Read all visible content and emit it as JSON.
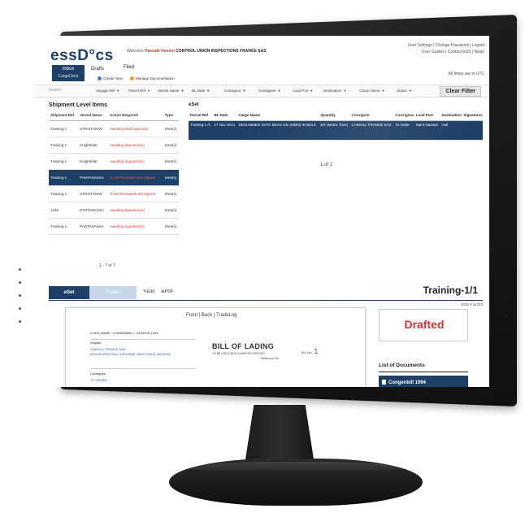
{
  "header": {
    "logo": "essD°cs",
    "welcome_prefix": "Welcome",
    "user_name": "Pascale Hossin",
    "company": "CONTROL UNION INSPECTIONS FRANCE SAS",
    "links_line1": "User Settings | Change Password | Logout",
    "links_line2": "User Guides | Contact ESS | News",
    "times_note": "All times are in UTC"
  },
  "tabs": {
    "inbox": "Inbox",
    "inbox_sub": "CargoDocs",
    "drafts": "Drafts",
    "filed": "Filed",
    "create_new": "Create New",
    "manage_docs": "Manage Documentation"
  },
  "filters": {
    "search_placeholder": "Search",
    "items": [
      "Voyage Ref",
      "Parcel Ref",
      "Vessel Name",
      "BL Date",
      "Consignor",
      "Consignee",
      "Load Port",
      "Destination",
      "Cargo Name",
      "Status"
    ],
    "clear_label": "Clear Filter"
  },
  "shipments": {
    "title": "Shipment Level Items",
    "columns": [
      "Shipment Ref",
      "Vessel Name",
      "Action Required",
      "Type"
    ],
    "rows": [
      {
        "ref": "Training-1",
        "vessel": "STRAITVIEW",
        "action": "Awaiting Draft Approval",
        "type": "eSet(s)",
        "selected": false
      },
      {
        "ref": "Training-1",
        "vessel": "Knightrider",
        "action": "Awaiting Signature(s)",
        "type": "eSet(s)",
        "selected": false
      },
      {
        "ref": "Training-1",
        "vessel": "Knightrider",
        "action": "Awaiting Signature(s)",
        "type": "eSet(s)",
        "selected": false
      },
      {
        "ref": "Training-1",
        "vessel": "PANTANASSA",
        "action": "To be Reviewed and Signed",
        "type": "eSet(s)",
        "selected": true
      },
      {
        "ref": "Training-1",
        "vessel": "STRAITVIEW",
        "action": "To be Reviewed and Signed",
        "type": "eSet(s)",
        "selected": false
      },
      {
        "ref": "1240",
        "vessel": "PANTANASSA",
        "action": "Awaiting Signature(s)",
        "type": "eSet(s)",
        "selected": false
      },
      {
        "ref": "Training-1",
        "vessel": "PANTANASSA",
        "action": "Awaiting Signature(s)",
        "type": "eSet(s)",
        "selected": false
      }
    ],
    "count": "1 - 7 of 7"
  },
  "eset": {
    "title": "eSet",
    "columns": [
      "Parcel Ref",
      "BL Date",
      "Cargo Name",
      "Quantity",
      "Consignor",
      "Consignee",
      "Load Port",
      "Destination",
      "Signatures"
    ],
    "row": {
      "parcel_ref": "Training-1 /1",
      "bl_date": "17 Nov 2014",
      "cargo": "DEGUMMED SOYA BEAN OIL (GMO) IN BULK",
      "quantity": "MT (Metric Tons)",
      "consignor": "CARGILL FRANCE SAS",
      "consignee": "To Order",
      "load_port": "Saint-Nazaire",
      "destination": "Hull",
      "signatures": ""
    },
    "pager": "1 of 1"
  },
  "lower": {
    "tab_eset": "eSet",
    "tab_folder": "Folder",
    "edit": "Edit",
    "pdf": "PDF",
    "doc_title": "Training-1/1",
    "ess_no": "ESS # 11763"
  },
  "document": {
    "links": "Front | Back | TradeLog",
    "code_name": "CODE NAME: \"CONGENBILL\". EDITION 1994",
    "shipper_label": "Shipper",
    "shipper_line1": "CARGILL FRANCE SAS",
    "shipper_line2": "BOULEVARD PAUL LEFERME 44600 SAINT NAZAIRE",
    "consignee_label": "Consignee",
    "consignee_value": "TO ORDER",
    "bol_title": "BILL OF LADING",
    "bol_sub": "TO BE USED WITH CHARTER-PARTIES",
    "reference_no": "Reference No.",
    "bl_no_label": "B/L No.",
    "bl_no_value": "1"
  },
  "status": {
    "text": "Drafted",
    "list_title": "List of Documents",
    "list_item": "Congenbill 1994"
  },
  "colors": {
    "navy": "#1e3f66",
    "alert_red": "#d63131",
    "link_blue": "#2a5db0"
  }
}
